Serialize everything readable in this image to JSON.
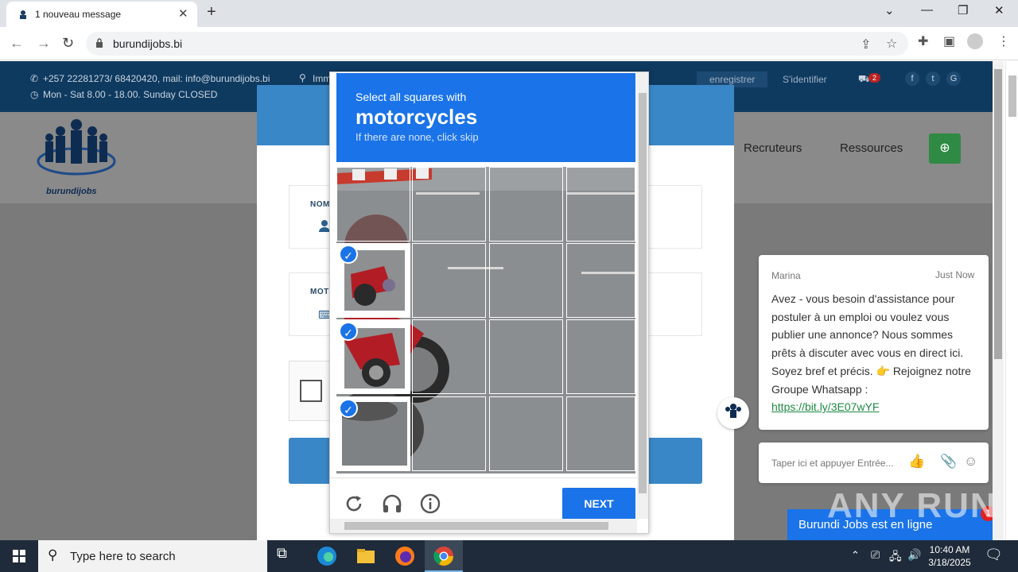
{
  "browser": {
    "tab_title": "1 nouveau message",
    "url": "burundijobs.bi"
  },
  "site": {
    "contact": "+257 22281273/ 68420420, mail: info@burundijobs.bi",
    "location_partial": "Imm",
    "hours": "Mon - Sat 8.00 - 18.00. Sunday CLOSED",
    "register": "enregistrer",
    "login": "S'identifier",
    "cart_count": "2",
    "logo_text": "burundijobs",
    "nav_recruteurs": "Recruteurs",
    "nav_ressources": "Ressources"
  },
  "form": {
    "name_label": "NOM",
    "password_label": "MOT"
  },
  "captcha": {
    "instruction": "Select all squares with",
    "target": "motorcycles",
    "hint": "If there are none, click skip",
    "next_label": "NEXT",
    "selected_cells": [
      "r2c1",
      "r3c1",
      "r4c1"
    ]
  },
  "chat": {
    "agent": "Marina",
    "time": "Just Now",
    "message": "Avez - vous besoin d'assistance pour postuler à un emploi ou voulez vous publier une annonce? Nous sommes prêts à discuter avec vous en direct ici. Soyez bref et précis. 👉 Rejoignez notre Groupe Whatsapp :",
    "link": "https://bit.ly/3E07wYF",
    "input_placeholder": "Taper ici et appuyer Entrée...",
    "status_bar": "Burundi Jobs est en ligne",
    "badge": "1"
  },
  "watermark": "ANY RUN",
  "taskbar": {
    "search_placeholder": "Type here to search",
    "time": "10:40 AM",
    "date": "3/18/2025"
  }
}
